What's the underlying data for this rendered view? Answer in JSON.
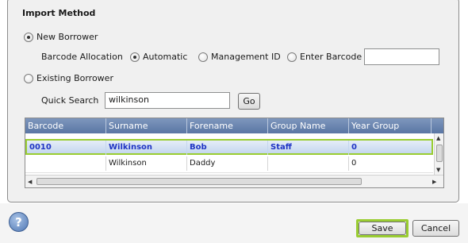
{
  "import_method": {
    "title": "Import Method",
    "new_borrower_label": "New Borrower",
    "barcode_allocation_label": "Barcode Allocation",
    "automatic_label": "Automatic",
    "management_id_label": "Management ID",
    "enter_barcode_label": "Enter Barcode",
    "barcode_value": "",
    "existing_borrower_label": "Existing Borrower",
    "quick_search_label": "Quick Search",
    "quick_search_value": "wilkinson",
    "go_label": "Go"
  },
  "grid": {
    "columns": [
      "Barcode",
      "Surname",
      "Forename",
      "Group Name",
      "Year Group"
    ],
    "rows": [
      {
        "barcode": "0010",
        "surname": "Wilkinson",
        "forename": "Bob",
        "group_name": "Staff",
        "year_group": "0",
        "selected": true
      },
      {
        "barcode": "",
        "surname": "Wilkinson",
        "forename": "Daddy",
        "group_name": "",
        "year_group": "0",
        "selected": false
      }
    ]
  },
  "footer": {
    "help_icon": "?",
    "save_label": "Save",
    "cancel_label": "Cancel"
  },
  "colors": {
    "header_blue": "#5a76a4",
    "selection_highlight": "#9acd32",
    "selected_text": "#1f34c4"
  }
}
